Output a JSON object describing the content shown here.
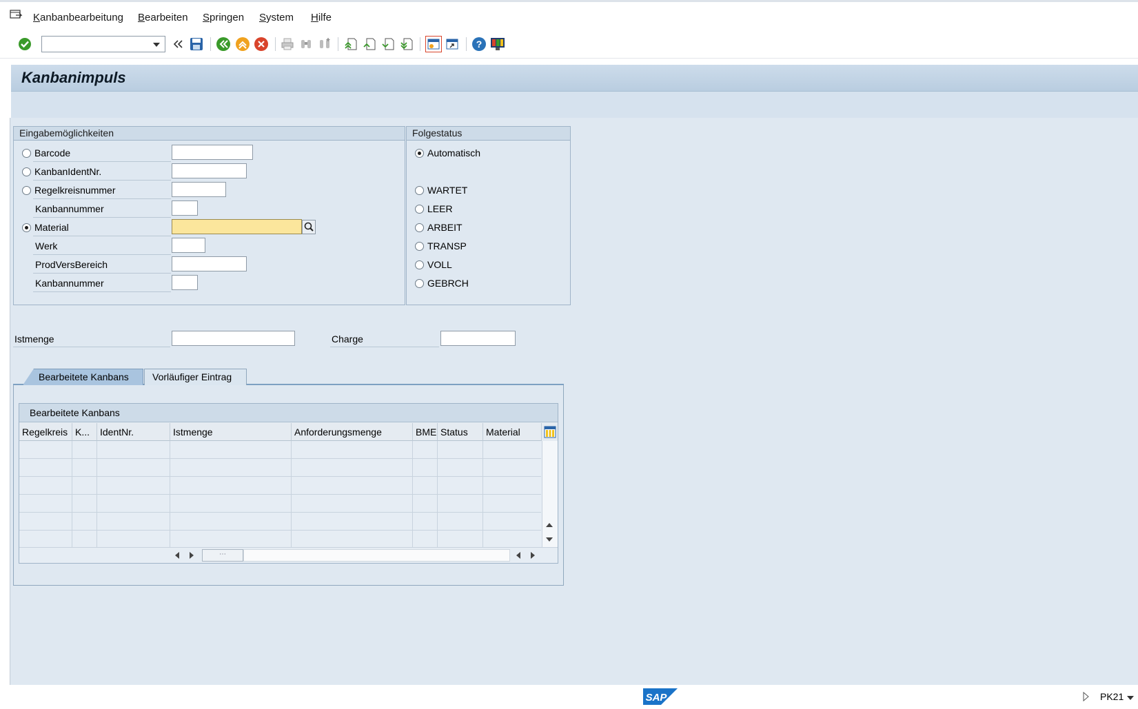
{
  "menu": {
    "items": [
      "Kanbanbearbeitung",
      "Bearbeiten",
      "Springen",
      "System",
      "Hilfe"
    ]
  },
  "toolbar": {
    "command_field_value": "",
    "icons": [
      "menu-icon",
      "enter-check-icon",
      "command-dropdown-icon",
      "collapse-toolbar-icon",
      "save-icon",
      "back-icon",
      "exit-icon",
      "cancel-icon",
      "print-icon",
      "find-icon",
      "find-next-icon",
      "first-page-icon",
      "previous-page-icon",
      "next-page-icon",
      "last-page-icon",
      "new-session-icon",
      "create-shortcut-icon",
      "help-icon",
      "customize-layout-icon"
    ],
    "colors": {
      "success": "#3a9a2a",
      "warning": "#f0a21e",
      "error": "#d9442b",
      "help": "#2a72b8"
    }
  },
  "title": "Kanbanimpuls",
  "input_group": {
    "header": "Eingabemöglichkeiten",
    "rows": [
      {
        "label": "Barcode",
        "has_radio": true,
        "selected": false,
        "value": ""
      },
      {
        "label": "KanbanIdentNr.",
        "has_radio": true,
        "selected": false,
        "value": ""
      },
      {
        "label": "Regelkreisnummer",
        "has_radio": true,
        "selected": false,
        "value": ""
      },
      {
        "label": "Kanbannummer",
        "has_radio": false,
        "value": ""
      },
      {
        "label": "Material",
        "has_radio": true,
        "selected": true,
        "value": ""
      },
      {
        "label": "Werk",
        "has_radio": false,
        "value": ""
      },
      {
        "label": "ProdVersBereich",
        "has_radio": false,
        "value": ""
      },
      {
        "label": "Kanbannummer",
        "has_radio": false,
        "value": ""
      }
    ]
  },
  "status_group": {
    "header": "Folgestatus",
    "options": [
      {
        "label": "Automatisch",
        "selected": true
      },
      {
        "label": "WARTET",
        "selected": false
      },
      {
        "label": "LEER",
        "selected": false
      },
      {
        "label": "ARBEIT",
        "selected": false
      },
      {
        "label": "TRANSP",
        "selected": false
      },
      {
        "label": "VOLL",
        "selected": false
      },
      {
        "label": "GEBRCH",
        "selected": false
      }
    ]
  },
  "quantity": {
    "label": "Istmenge",
    "value": ""
  },
  "batch": {
    "label": "Charge",
    "value": ""
  },
  "tabs": [
    {
      "label": "Bearbeitete Kanbans",
      "active": true
    },
    {
      "label": "Vorläufiger Eintrag",
      "active": false
    }
  ],
  "table": {
    "title": "Bearbeitete Kanbans",
    "columns": [
      "Regelkreis",
      "K...",
      "IdentNr.",
      "Istmenge",
      "Anforderungsmenge",
      "BME",
      "Status",
      "Material"
    ],
    "rows": []
  },
  "statusbar": {
    "logo": "SAP",
    "transaction": "PK21"
  }
}
